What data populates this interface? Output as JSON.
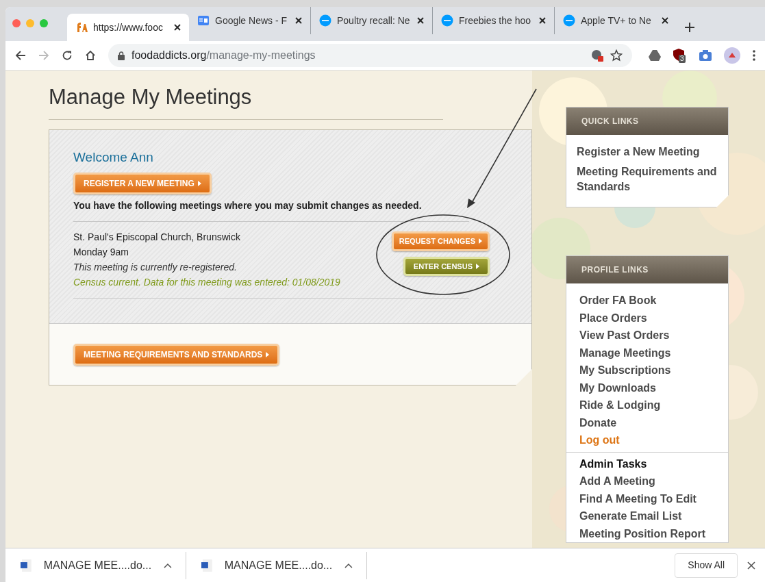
{
  "tabs": [
    {
      "title": "https://www.fooc",
      "selected": true
    },
    {
      "title": "Google News - F",
      "selected": false
    },
    {
      "title": "Poultry recall: Ne",
      "selected": false
    },
    {
      "title": "Freebies the hoo",
      "selected": false
    },
    {
      "title": "Apple TV+ to Ne",
      "selected": false
    }
  ],
  "toolbar": {
    "url_host": "foodaddicts.org",
    "url_path": "/manage-my-meetings",
    "extension_badge": "3"
  },
  "page": {
    "title": "Manage My Meetings",
    "welcome": "Welcome Ann",
    "register_button": "REGISTER A NEW MEETING",
    "intro": "You have the following meetings where you may submit changes as needed.",
    "meeting": {
      "name": "St. Paul's Episcopal Church, Brunswick",
      "time": "Monday 9am",
      "status": "This meeting is currently re-registered.",
      "census": "Census current. Data for this meeting was entered: 01/08/2019",
      "request_button": "REQUEST CHANGES",
      "census_button": "ENTER CENSUS"
    },
    "requirements_button": "MEETING REQUIREMENTS AND STANDARDS"
  },
  "quick_links": {
    "title": "QUICK LINKS",
    "items": [
      "Register a New Meeting",
      "Meeting Requirements and Standards"
    ]
  },
  "profile_links": {
    "title": "PROFILE LINKS",
    "items": [
      {
        "label": "Order FA Book",
        "kind": "link"
      },
      {
        "label": "Place Orders",
        "kind": "link"
      },
      {
        "label": "View Past Orders",
        "kind": "link"
      },
      {
        "label": "Manage Meetings",
        "kind": "link"
      },
      {
        "label": "My Subscriptions",
        "kind": "link"
      },
      {
        "label": "My Downloads",
        "kind": "link"
      },
      {
        "label": "Ride & Lodging",
        "kind": "link"
      },
      {
        "label": "Donate",
        "kind": "link"
      },
      {
        "label": "Log out",
        "kind": "logout"
      },
      {
        "label": "Admin Tasks",
        "kind": "heading"
      },
      {
        "label": "Add A Meeting",
        "kind": "link"
      },
      {
        "label": "Find A Meeting To Edit",
        "kind": "link"
      },
      {
        "label": "Generate Email List",
        "kind": "link"
      },
      {
        "label": "Meeting Position Report",
        "kind": "link"
      }
    ]
  },
  "downloads": {
    "items": [
      "MANAGE MEE....do...",
      "MANAGE MEE....do..."
    ],
    "show_all": "Show All"
  }
}
